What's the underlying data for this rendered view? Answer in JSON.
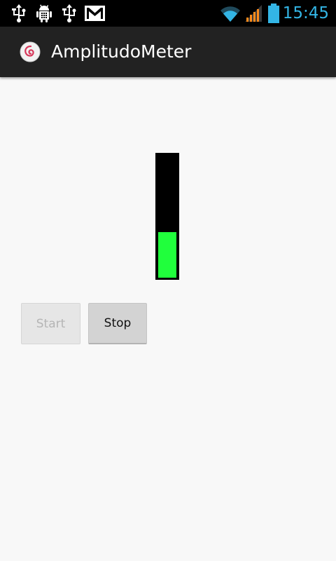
{
  "status_bar": {
    "time": "15:45",
    "time_color": "#33b5e5",
    "left_icons": [
      "usb-icon",
      "android-debug-icon",
      "usb-icon",
      "gmail-icon"
    ],
    "right_icons": [
      "wifi-icon",
      "signal-icon",
      "battery-icon"
    ]
  },
  "action_bar": {
    "title": "AmplitudoMeter",
    "icon": "app-logo-icon",
    "background": "#222222"
  },
  "meter": {
    "level": 0.37,
    "fill_color": "#20ff3c",
    "background": "#000000"
  },
  "buttons": {
    "start_label": "Start",
    "start_enabled": false,
    "stop_label": "Stop",
    "stop_enabled": true
  }
}
